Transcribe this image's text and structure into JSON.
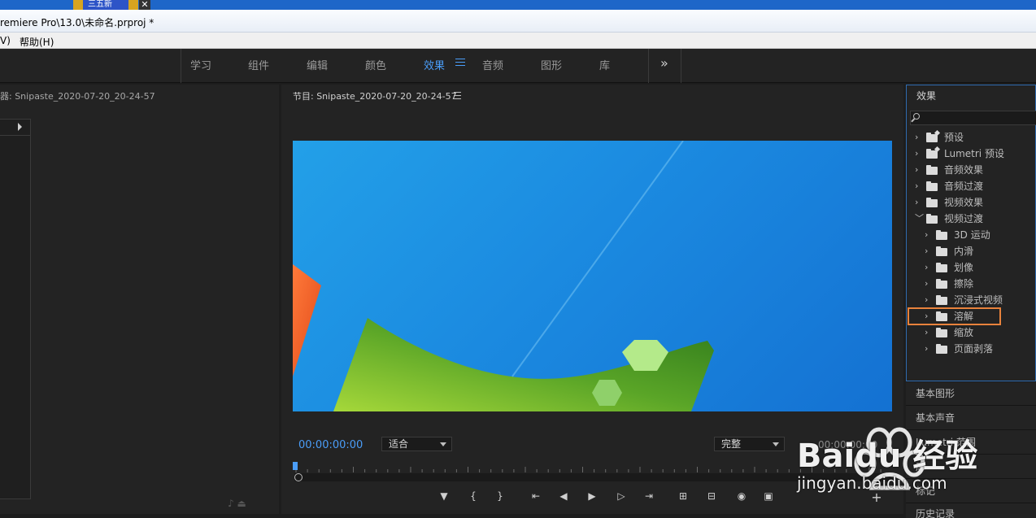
{
  "taskbar": {
    "tab_label": "三五新",
    "close_glyph": "✕"
  },
  "window": {
    "title": "remiere Pro\\13.0\\未命名.prproj *"
  },
  "menubar": {
    "items": [
      "V)",
      "帮助(H)"
    ]
  },
  "workspace": {
    "items": [
      "学习",
      "组件",
      "编辑",
      "颜色",
      "效果",
      "音频",
      "图形",
      "库"
    ],
    "active": "效果",
    "more_glyph": "»"
  },
  "source_panel": {
    "title": "器: Snipaste_2020-07-20_20-24-57"
  },
  "program_panel": {
    "title": "节目: Snipaste_2020-07-20_20-24-57",
    "timecode": "00:00:00:00",
    "fit_select": "适合",
    "quality_select": "完整",
    "end_timecode": "00:00:00:00",
    "controls": [
      "▼",
      "{",
      "}",
      "⇤",
      "◀",
      "▶",
      "▷",
      "⇥",
      "⊞",
      "⊟",
      "◉",
      "▣"
    ],
    "add_glyph": "+"
  },
  "effects_panel": {
    "title": "效果",
    "tree": [
      {
        "label": "预设",
        "expanded": false,
        "level": 0,
        "icon": "folder-star"
      },
      {
        "label": "Lumetri 预设",
        "expanded": false,
        "level": 0,
        "icon": "folder-star"
      },
      {
        "label": "音频效果",
        "expanded": false,
        "level": 0,
        "icon": "folder"
      },
      {
        "label": "音频过渡",
        "expanded": false,
        "level": 0,
        "icon": "folder"
      },
      {
        "label": "视频效果",
        "expanded": false,
        "level": 0,
        "icon": "folder"
      },
      {
        "label": "视频过渡",
        "expanded": true,
        "level": 0,
        "icon": "folder"
      },
      {
        "label": "3D 运动",
        "expanded": false,
        "level": 1,
        "icon": "folder"
      },
      {
        "label": "内滑",
        "expanded": false,
        "level": 1,
        "icon": "folder"
      },
      {
        "label": "划像",
        "expanded": false,
        "level": 1,
        "icon": "folder"
      },
      {
        "label": "擦除",
        "expanded": false,
        "level": 1,
        "icon": "folder"
      },
      {
        "label": "沉浸式视频",
        "expanded": false,
        "level": 1,
        "icon": "folder"
      },
      {
        "label": "溶解",
        "expanded": false,
        "level": 1,
        "icon": "folder",
        "highlighted": true
      },
      {
        "label": "缩放",
        "expanded": false,
        "level": 1,
        "icon": "folder"
      },
      {
        "label": "页面剥落",
        "expanded": false,
        "level": 1,
        "icon": "folder"
      }
    ]
  },
  "side_panels": [
    "基本图形",
    "基本声音",
    "Lumetri 范围",
    "库",
    "标记",
    "历史记录"
  ],
  "watermark": {
    "text": "Baidu 经验",
    "url": "jingyan.baidu.com"
  },
  "colors": {
    "accent": "#4a9df8",
    "highlight": "#e8823c",
    "panel": "#232323"
  }
}
